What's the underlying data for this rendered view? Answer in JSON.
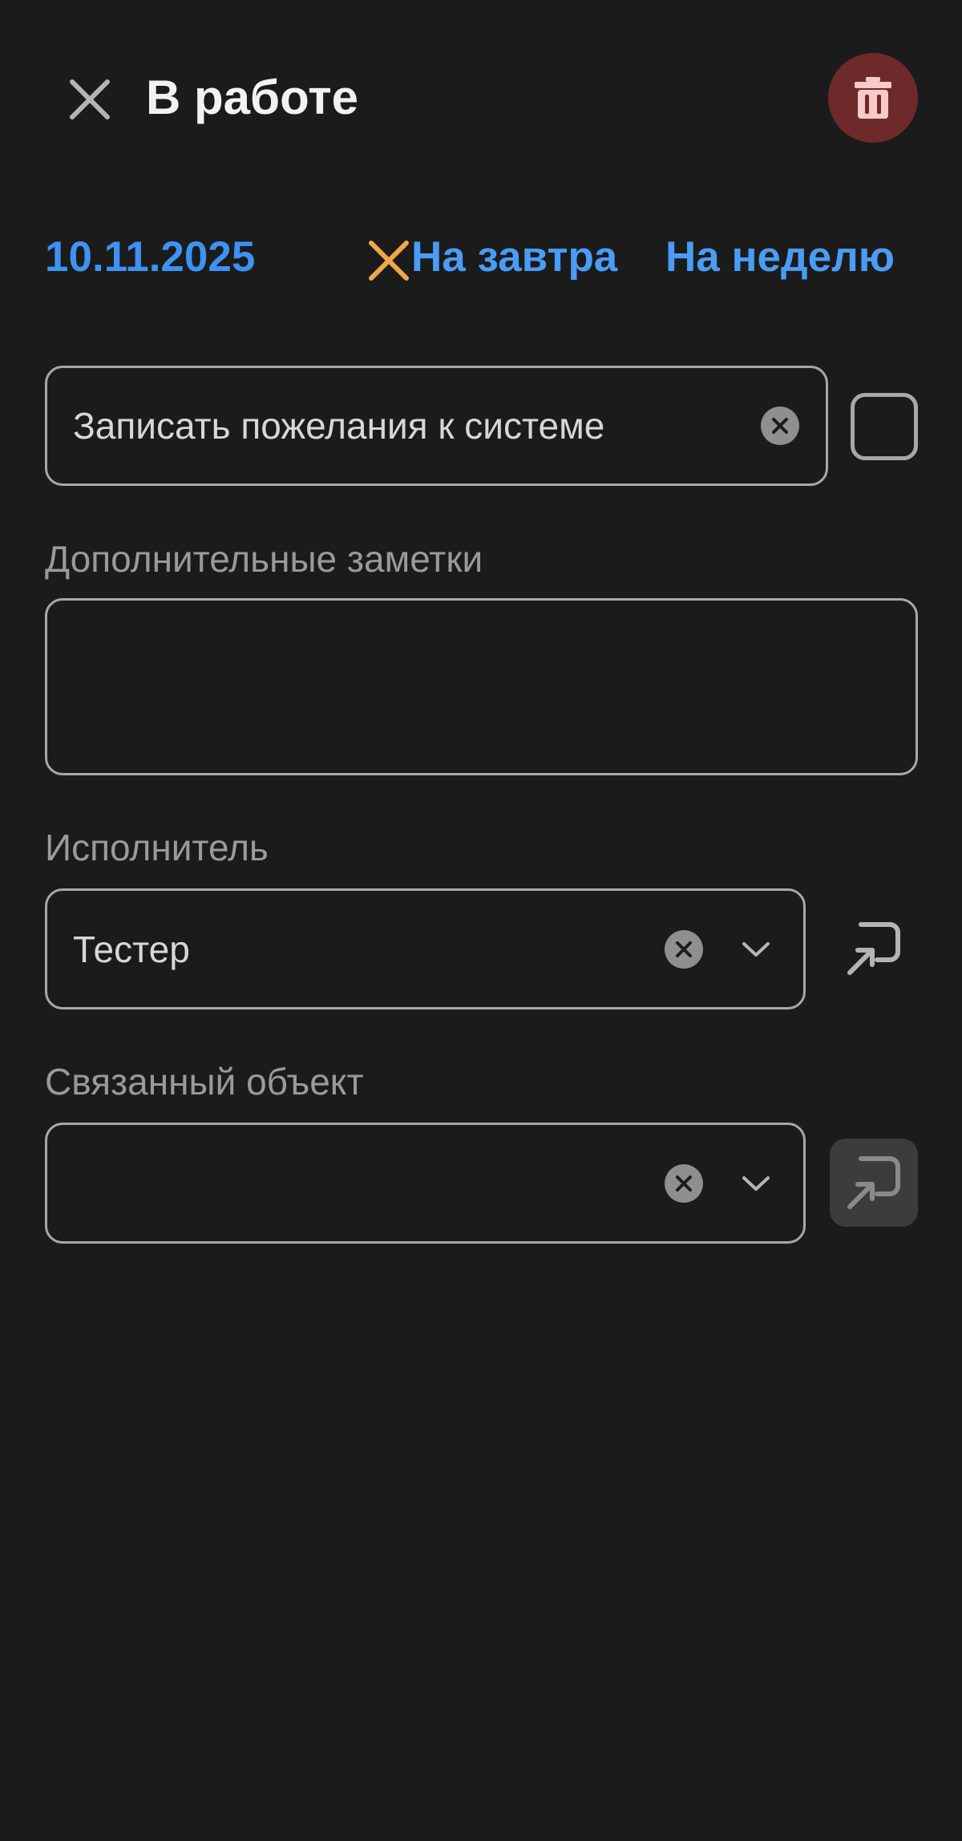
{
  "header": {
    "title": "В работе",
    "close_icon": "close-icon",
    "delete_icon": "trash-icon",
    "delete_bg": "#6e2a2a"
  },
  "date_row": {
    "date": "10.11.2025",
    "clear_icon": "x-icon",
    "clear_color": "#f2a64a",
    "tomorrow_label": "На завтра",
    "week_label": "На неделю"
  },
  "task": {
    "value": "Записать пожелания к системе",
    "done": false
  },
  "notes": {
    "label": "Дополнительные заметки",
    "value": ""
  },
  "executor": {
    "label": "Исполнитель",
    "value": "Тестер"
  },
  "related_object": {
    "label": "Связанный объект",
    "value": ""
  },
  "colors": {
    "background": "#1b1b1b",
    "accent": "#3d92f2",
    "border": "#a8a8a8"
  }
}
